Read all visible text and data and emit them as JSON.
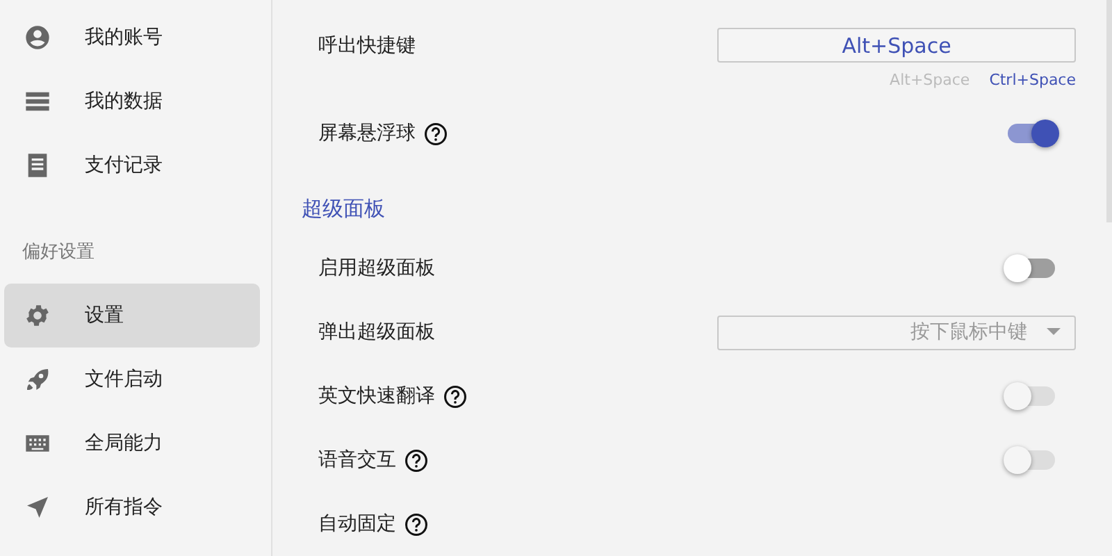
{
  "sidebar": {
    "items": [
      {
        "kind": "item",
        "label": "我的账号",
        "selected": false
      },
      {
        "kind": "item",
        "label": "我的数据",
        "selected": false
      },
      {
        "kind": "item",
        "label": "支付记录",
        "selected": false
      },
      {
        "kind": "heading",
        "label": "偏好设置"
      },
      {
        "kind": "item",
        "label": "设置",
        "selected": true
      },
      {
        "kind": "item",
        "label": "文件启动",
        "selected": false
      },
      {
        "kind": "item",
        "label": "全局能力",
        "selected": false
      },
      {
        "kind": "item",
        "label": "所有指令",
        "selected": false
      }
    ]
  },
  "settings": [
    {
      "kind": "hotkey",
      "label": "呼出快捷键",
      "value": "Alt+Space",
      "options": [
        {
          "label": "Alt+Space",
          "selected": true
        },
        {
          "label": "Ctrl+Space",
          "selected": false
        }
      ]
    },
    {
      "kind": "toggle",
      "label": "屏幕悬浮球",
      "help": true,
      "on": true,
      "disabled": false
    },
    {
      "kind": "heading",
      "label": "超级面板"
    },
    {
      "kind": "toggle",
      "label": "启用超级面板",
      "help": false,
      "on": false,
      "disabled": false
    },
    {
      "kind": "select",
      "label": "弹出超级面板",
      "value": "按下鼠标中键"
    },
    {
      "kind": "toggle",
      "label": "英文快速翻译",
      "help": true,
      "on": false,
      "disabled": true
    },
    {
      "kind": "toggle",
      "label": "语音交互",
      "help": true,
      "on": false,
      "disabled": true
    },
    {
      "kind": "label",
      "label": "自动固定",
      "help": true
    }
  ]
}
